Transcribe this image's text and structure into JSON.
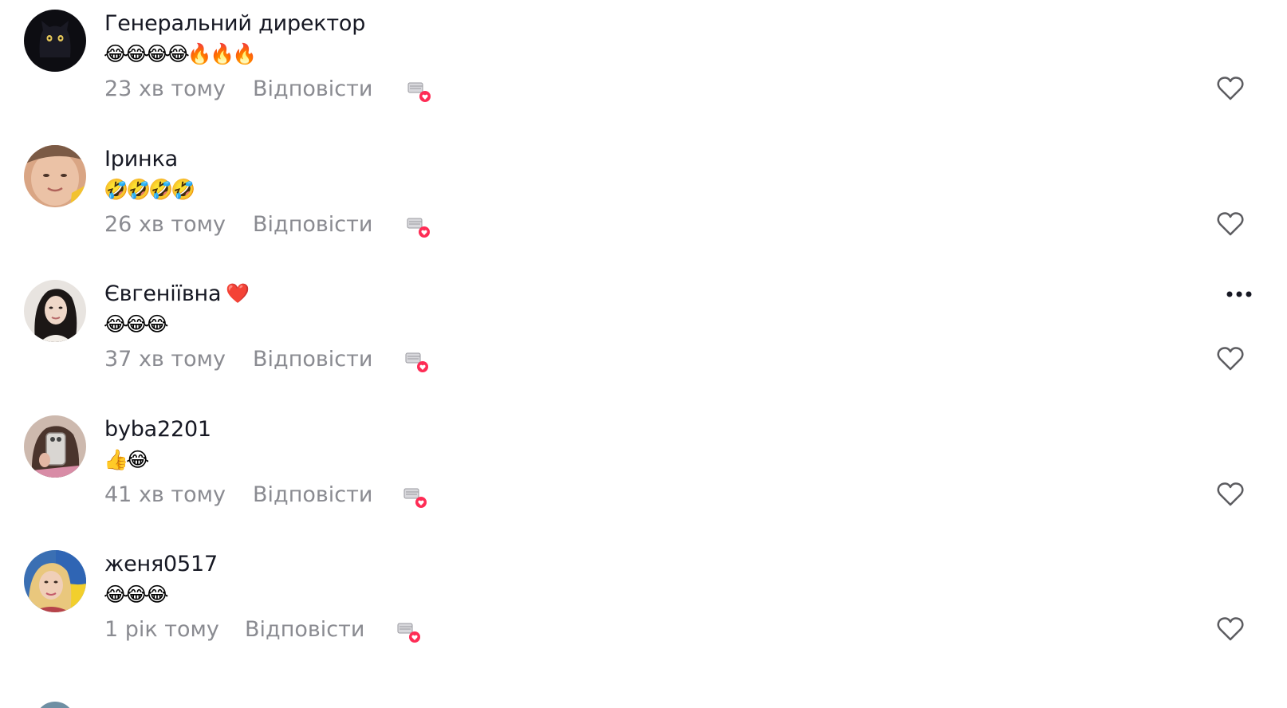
{
  "reply_label": "Відповісти",
  "comments": [
    {
      "username": "Генеральний директор",
      "text": "😂😂😂😂🔥🔥🔥",
      "timestamp": "23 хв тому",
      "avatar": "black-cat-avatar"
    },
    {
      "username": "Іринка",
      "text": "🤣🤣🤣🤣",
      "timestamp": "26 хв тому",
      "avatar": "woman-avatar"
    },
    {
      "username": "Євгеніївна",
      "username_badge": "❤️",
      "text": "😂😂😂",
      "timestamp": "37 хв тому",
      "avatar": "woman-dark-hair-avatar"
    },
    {
      "username": "byba2201",
      "text": "👍😂",
      "timestamp": "41 хв тому",
      "avatar": "mirror-selfie-avatar"
    },
    {
      "username": "женя0517",
      "text": "😂😂😂",
      "timestamp": "1 рік тому",
      "avatar": "woman-flag-avatar"
    }
  ],
  "icons": {
    "like": "heart-outline-icon",
    "creator_liked": "creator-liked-icon",
    "more": "more-dots-icon"
  },
  "colors": {
    "username": "#161823",
    "secondary_text": "#8a8b91",
    "like_outline": "#5c5c60",
    "creator_heart": "#fe2c55"
  }
}
